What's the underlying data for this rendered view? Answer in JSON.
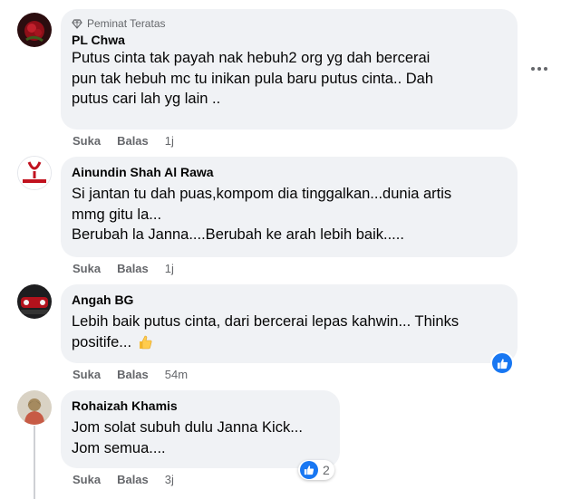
{
  "comments": [
    {
      "badge": "Peminat Teratas",
      "author": "PL Chwa",
      "lines": [
        "Putus cinta tak payah nak hebuh2 org yg dah bercerai",
        "pun tak hebuh mc tu inikan pula baru putus cinta.. Dah",
        "putus cari lah yg lain .."
      ],
      "like_label": "Suka",
      "reply_label": "Balas",
      "time": "1j"
    },
    {
      "author": "Ainundin Shah Al Rawa",
      "lines": [
        "Si jantan tu dah puas,kompom dia tinggalkan...dunia artis",
        "mmg gitu la...",
        "Berubah la Janna....Berubah ke arah lebih baik....."
      ],
      "like_label": "Suka",
      "reply_label": "Balas",
      "time": "1j"
    },
    {
      "author": "Angah BG",
      "lines": [
        "Lebih baik putus cinta, dari bercerai lepas kahwin... Thinks",
        "positife..."
      ],
      "like_label": "Suka",
      "reply_label": "Balas",
      "time": "54m"
    },
    {
      "author": "Rohaizah Khamis",
      "lines": [
        "Jom solat subuh dulu Janna Kick...",
        "Jom semua...."
      ],
      "like_label": "Suka",
      "reply_label": "Balas",
      "time": "3j",
      "reaction_count": "2"
    }
  ],
  "colors": {
    "bubble": "#f0f2f5",
    "meta": "#65676b",
    "like_blue": "#1877f2"
  },
  "icons": [
    "diamond-icon",
    "more-options-icon",
    "thumbs-up-icon",
    "thumbs-up-emoji"
  ]
}
